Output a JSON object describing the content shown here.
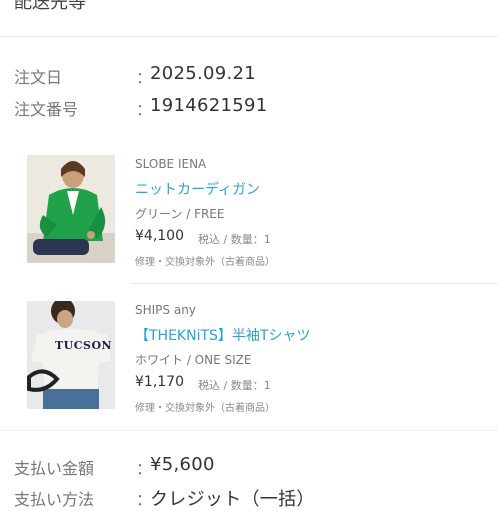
{
  "header": {
    "title": "配送先等"
  },
  "order": {
    "date_label": "注文日",
    "date_value": "2025.09.21",
    "number_label": "注文番号",
    "number_value": "1914621591",
    "colon": "："
  },
  "items": [
    {
      "brand": "SLOBE IENA",
      "name": "ニットカーディガン",
      "variant": "グリーン / FREE",
      "price": "¥4,100",
      "tax_qty": "税込 / 数量：1",
      "note": "修理・交換対象外（古着商品）"
    },
    {
      "brand": "SHIPS any",
      "name": "【THEKNiTS】半袖Tシャツ",
      "variant": "ホワイト / ONE SIZE",
      "price": "¥1,170",
      "tax_qty": "税込 / 数量：1",
      "note": "修理・交換対象外（古着商品）",
      "shirt_print": "TUCSON"
    }
  ],
  "payment": {
    "amount_label": "支払い金額",
    "amount_value": "¥5,600",
    "method_label": "支払い方法",
    "method_value": "クレジット（一括）"
  },
  "colors": {
    "link": "#27a3d9",
    "label": "#777777",
    "text": "#333333"
  }
}
